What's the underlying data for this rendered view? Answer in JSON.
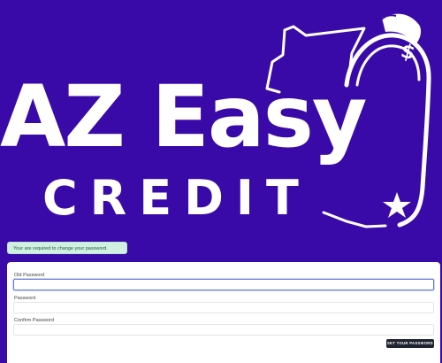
{
  "logo": {
    "line1": "AZ Easy",
    "line2": "CREDIT",
    "icon_name": "arizona-money-bag-icon",
    "dollar_glyph": "$",
    "star_icon": "star-icon"
  },
  "alert": {
    "message": "Your are required to change your password."
  },
  "form": {
    "old_password_label": "Old Password",
    "old_password_value": "",
    "password_label": "Password",
    "password_value": "",
    "confirm_password_label": "Confirm Password",
    "confirm_password_value": "",
    "submit_label": "SET YOUR PASSWORD"
  },
  "colors": {
    "background": "#3a0aa8",
    "logo": "#ffffff",
    "alert_bg": "#d1f0e2",
    "alert_text": "#1d5e42",
    "button_bg": "#1f2431",
    "focus_border": "#6b7fd6"
  }
}
